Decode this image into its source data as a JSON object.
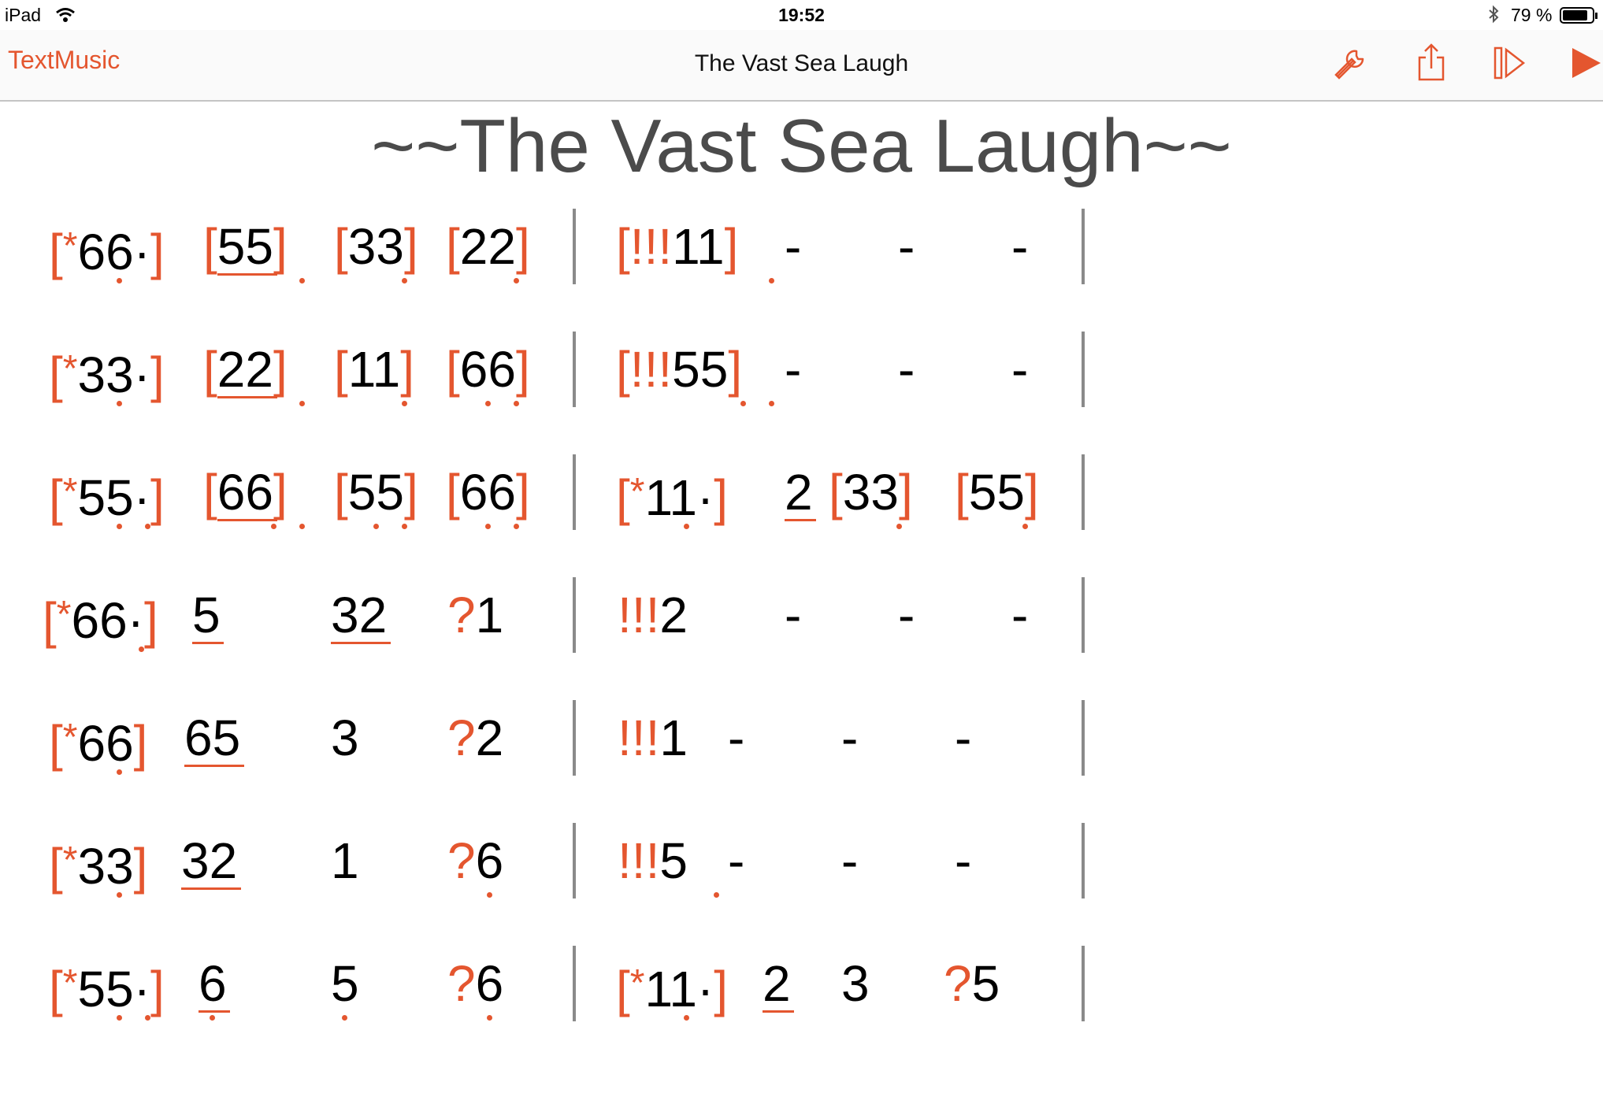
{
  "status": {
    "device": "iPad",
    "time": "19:52",
    "battery": "79 %"
  },
  "nav": {
    "back": "TextMusic",
    "title": "The Vast Sea Laugh",
    "icons": [
      "wrench-icon",
      "share-icon",
      "step-play-icon",
      "play-icon"
    ]
  },
  "sheet": {
    "title": "~~The Vast Sea Laugh~~",
    "rows": [
      [
        "[*66·]",
        "[55]",
        "[33]",
        "[22]",
        "|",
        "[!!!11]",
        "-",
        "-",
        "-",
        "|"
      ],
      [
        "[*33·]",
        "[22]",
        "[11]",
        "[66]",
        "|",
        "[!!!55]",
        "-",
        "-",
        "-",
        "|"
      ],
      [
        "[*55·]",
        "[66]",
        "[55]",
        "[66]",
        "|",
        "[*11·]",
        "2",
        "[33]",
        "[55]",
        "|"
      ],
      [
        "[*66·]",
        "5",
        "32",
        "?1",
        "|",
        "!!!2",
        "-",
        "-",
        "-",
        "|"
      ],
      [
        "[*66]",
        "65",
        "3",
        "?2",
        "|",
        "!!!1",
        "-",
        "-",
        "-",
        "|"
      ],
      [
        "[*33]",
        "32",
        "1",
        "?6",
        "|",
        "!!!5",
        "-",
        "-",
        "-",
        "|"
      ],
      [
        "[*55·]",
        "6",
        "5",
        "?6",
        "|",
        "[*11·]",
        "2",
        "3",
        "?5",
        "|"
      ]
    ]
  },
  "colors": {
    "accent": "#e4562f",
    "bar": "#8a8a8a",
    "title": "#4b4b4b"
  }
}
